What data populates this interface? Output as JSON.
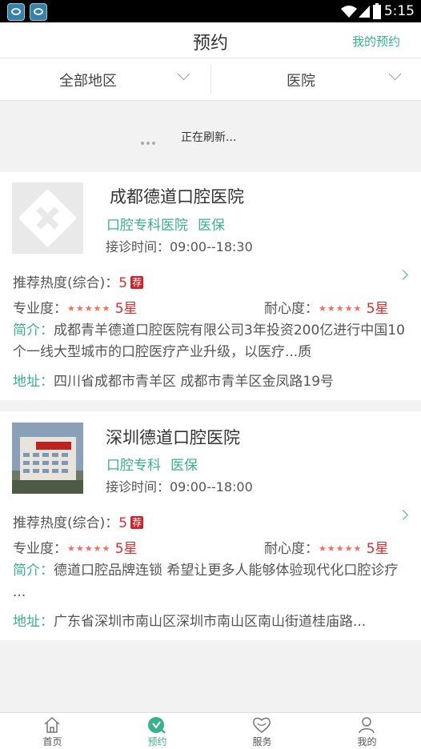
{
  "status_bar": {
    "time": "5:15"
  },
  "header": {
    "title": "预约",
    "my_appointments": "我的预约"
  },
  "filters": {
    "region": "全部地区",
    "type": "医院"
  },
  "refresh": {
    "text": "正在刷新..."
  },
  "labels": {
    "popularity": "推荐热度(综合)：",
    "professionalism": "专业度：",
    "patience": "耐心度：",
    "intro": "简介：",
    "address": "地址：",
    "recommend_badge": "荐"
  },
  "hospitals": [
    {
      "name": "成都德道口腔医院",
      "tags": [
        "口腔专科医院",
        "医保"
      ],
      "hours": "接诊时间：09:00--18:30",
      "popularity": "5",
      "professional_rating": "5星",
      "patience_rating": "5星",
      "intro": "成都青羊德道口腔医院有限公司3年投资200亿进行中国10个一线大型城市的口腔医疗产业升级，以医疗...质",
      "address": "四川省成都市青羊区 成都市青羊区金凤路19号"
    },
    {
      "name": "深圳德道口腔医院",
      "tags": [
        "口腔专科",
        "医保"
      ],
      "hours": "接诊时间：09:00--18:00",
      "popularity": "5",
      "professional_rating": "5星",
      "patience_rating": "5星",
      "intro": "德道口腔品牌连锁 希望让更多人能够体验现代化口腔诊疗 ...",
      "address": "广东省深圳市南山区深圳市南山区南山街道桂庙路..."
    }
  ],
  "tabbar": {
    "items": [
      "首页",
      "预约",
      "服务",
      "我的"
    ],
    "active_index": 1
  }
}
